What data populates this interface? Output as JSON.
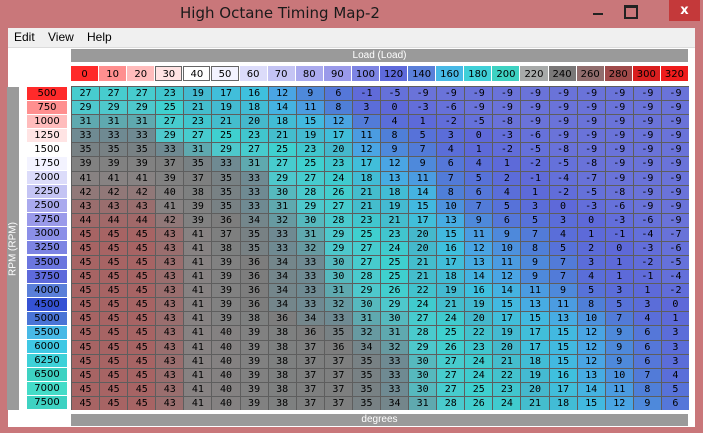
{
  "window": {
    "title": "High Octane Timing Map-2",
    "close_glyph": "x"
  },
  "menu": [
    "Edit",
    "View",
    "Help"
  ],
  "table": {
    "x_axis_label": "Load (Load)",
    "y_axis_label": "RPM (RPM)",
    "z_unit_label": "degrees",
    "load_bins": [
      "0",
      "10",
      "20",
      "30",
      "40",
      "50",
      "60",
      "70",
      "80",
      "90",
      "100",
      "120",
      "140",
      "160",
      "180",
      "200",
      "220",
      "240",
      "260",
      "280",
      "300",
      "320"
    ],
    "load_bin_colors": [
      "#ff2a2a",
      "#ff8f8f",
      "#ffbcbc",
      "#ffe4e4",
      "#ffffff",
      "#f3f3ff",
      "#dcdcfa",
      "#c4c4f4",
      "#aaaaee",
      "#9a9aea",
      "#7d84e3",
      "#5e6adb",
      "#5a7fd9",
      "#48b9e6",
      "#3fd0d8",
      "#3ed2c2",
      "#a7aaa9",
      "#7a7878",
      "#916d6d",
      "#a04a4a",
      "#d91f1f",
      "#ef1c1c"
    ],
    "rpm_bins": [
      "500",
      "750",
      "1000",
      "1250",
      "1500",
      "1750",
      "2000",
      "2250",
      "2500",
      "2750",
      "3000",
      "3250",
      "3500",
      "3750",
      "4000",
      "4500",
      "5000",
      "5500",
      "6000",
      "6250",
      "6500",
      "7000",
      "7500"
    ],
    "rpm_bin_colors": [
      "#ff2a2a",
      "#ff8f8f",
      "#ffbcbc",
      "#ffe4e4",
      "#ffffff",
      "#f3f3ff",
      "#dcdcfa",
      "#c4c4f4",
      "#aaaaee",
      "#9a9aea",
      "#8b8fe8",
      "#7d84e3",
      "#6b76df",
      "#5e6adb",
      "#5a7fd9",
      "#3552d4",
      "#4a74d6",
      "#48b9e6",
      "#3fc8e4",
      "#3ed1d8",
      "#3ed2c2",
      "#44dcc8",
      "#3ed2c2"
    ],
    "values": [
      [
        27,
        27,
        27,
        23,
        19,
        17,
        16,
        12,
        9,
        6,
        -1,
        -5,
        -9,
        -9,
        -9,
        -9,
        -9,
        -9,
        -9,
        -9,
        -9,
        -9
      ],
      [
        29,
        29,
        29,
        25,
        21,
        19,
        18,
        14,
        11,
        8,
        3,
        0,
        -3,
        -6,
        -9,
        -9,
        -9,
        -9,
        -9,
        -9,
        -9,
        -9
      ],
      [
        31,
        31,
        31,
        27,
        23,
        21,
        20,
        18,
        15,
        12,
        7,
        4,
        1,
        -2,
        -5,
        -8,
        -9,
        -9,
        -9,
        -9,
        -9,
        -9
      ],
      [
        33,
        33,
        33,
        29,
        27,
        25,
        23,
        21,
        19,
        17,
        11,
        8,
        5,
        3,
        0,
        -3,
        -6,
        -9,
        -9,
        -9,
        -9,
        -9
      ],
      [
        35,
        35,
        35,
        33,
        31,
        29,
        27,
        25,
        23,
        20,
        12,
        9,
        7,
        4,
        1,
        -2,
        -5,
        -8,
        -9,
        -9,
        -9,
        -9
      ],
      [
        39,
        39,
        39,
        37,
        35,
        33,
        31,
        27,
        25,
        23,
        17,
        12,
        9,
        6,
        4,
        1,
        -2,
        -5,
        -8,
        -9,
        -9,
        -9
      ],
      [
        41,
        41,
        41,
        39,
        37,
        35,
        33,
        29,
        27,
        24,
        18,
        13,
        11,
        7,
        5,
        2,
        -1,
        -4,
        -7,
        -9,
        -9,
        -9
      ],
      [
        42,
        42,
        42,
        40,
        38,
        35,
        33,
        30,
        28,
        26,
        21,
        18,
        14,
        8,
        6,
        4,
        1,
        -2,
        -5,
        -8,
        -9,
        -9
      ],
      [
        43,
        43,
        43,
        41,
        39,
        35,
        33,
        31,
        29,
        27,
        21,
        19,
        15,
        10,
        7,
        5,
        3,
        0,
        -3,
        -6,
        -9,
        -9
      ],
      [
        44,
        44,
        44,
        42,
        39,
        36,
        34,
        32,
        30,
        28,
        23,
        21,
        17,
        13,
        9,
        6,
        5,
        3,
        0,
        -3,
        -6,
        -9
      ],
      [
        45,
        45,
        45,
        43,
        41,
        37,
        35,
        33,
        31,
        29,
        25,
        23,
        20,
        15,
        11,
        9,
        7,
        4,
        1,
        -1,
        -4,
        -7
      ],
      [
        45,
        45,
        45,
        43,
        41,
        38,
        35,
        33,
        32,
        29,
        27,
        24,
        20,
        16,
        12,
        10,
        8,
        5,
        2,
        0,
        -3,
        -6
      ],
      [
        45,
        45,
        45,
        43,
        41,
        39,
        36,
        34,
        33,
        30,
        27,
        25,
        21,
        17,
        13,
        11,
        9,
        7,
        3,
        1,
        -2,
        -5
      ],
      [
        45,
        45,
        45,
        43,
        41,
        39,
        36,
        34,
        33,
        30,
        28,
        25,
        21,
        18,
        14,
        12,
        9,
        7,
        4,
        1,
        -1,
        -4
      ],
      [
        45,
        45,
        45,
        43,
        41,
        39,
        36,
        34,
        33,
        31,
        29,
        26,
        22,
        19,
        16,
        14,
        11,
        9,
        5,
        3,
        1,
        -2
      ],
      [
        45,
        45,
        45,
        43,
        41,
        39,
        36,
        34,
        33,
        32,
        30,
        29,
        24,
        21,
        19,
        15,
        13,
        11,
        8,
        5,
        3,
        0
      ],
      [
        45,
        45,
        45,
        43,
        41,
        39,
        38,
        36,
        34,
        33,
        31,
        30,
        27,
        24,
        20,
        17,
        15,
        13,
        10,
        7,
        4,
        1
      ],
      [
        45,
        45,
        45,
        43,
        41,
        40,
        39,
        38,
        36,
        35,
        32,
        31,
        28,
        25,
        22,
        19,
        17,
        15,
        12,
        9,
        6,
        3
      ],
      [
        45,
        45,
        45,
        43,
        41,
        40,
        39,
        38,
        37,
        36,
        34,
        32,
        29,
        26,
        23,
        20,
        17,
        15,
        12,
        9,
        6,
        3
      ],
      [
        45,
        45,
        45,
        43,
        41,
        40,
        39,
        38,
        37,
        37,
        35,
        33,
        30,
        27,
        24,
        21,
        18,
        15,
        12,
        9,
        6,
        3
      ],
      [
        45,
        45,
        45,
        43,
        41,
        40,
        39,
        38,
        37,
        37,
        35,
        33,
        30,
        27,
        24,
        22,
        19,
        16,
        13,
        10,
        7,
        4
      ],
      [
        45,
        45,
        45,
        43,
        41,
        40,
        39,
        38,
        37,
        37,
        35,
        33,
        30,
        27,
        25,
        23,
        20,
        17,
        14,
        11,
        8,
        5
      ],
      [
        45,
        45,
        45,
        43,
        41,
        40,
        39,
        38,
        37,
        37,
        35,
        34,
        31,
        28,
        26,
        24,
        21,
        18,
        15,
        12,
        9,
        6
      ]
    ]
  }
}
